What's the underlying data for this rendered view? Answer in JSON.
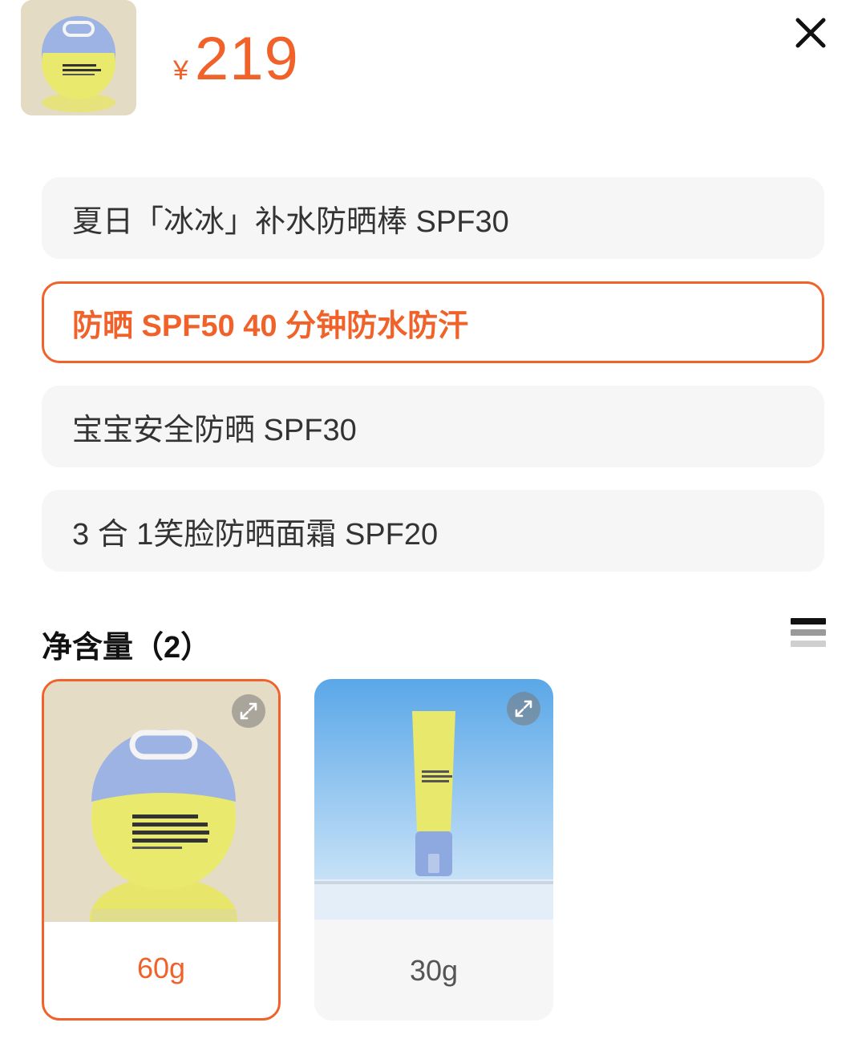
{
  "header": {
    "currency": "¥",
    "price": "219"
  },
  "variants": [
    {
      "label": "夏日「冰冰」补水防晒棒 SPF30",
      "selected": false
    },
    {
      "label": "防晒 SPF50 40 分钟防水防汗",
      "selected": true
    },
    {
      "label": "宝宝安全防晒 SPF30",
      "selected": false
    },
    {
      "label": "3 合 1笑脸防晒面霜 SPF20",
      "selected": false
    }
  ],
  "size_section": {
    "title": "净含量（2）",
    "options": [
      {
        "label": "60g",
        "selected": true
      },
      {
        "label": "30g",
        "selected": false
      }
    ]
  },
  "colors": {
    "accent": "#f0622a",
    "option_bg": "#f6f6f6"
  },
  "icons": {
    "close": "close-icon",
    "list_view": "list-view-icon",
    "expand": "expand-icon"
  }
}
